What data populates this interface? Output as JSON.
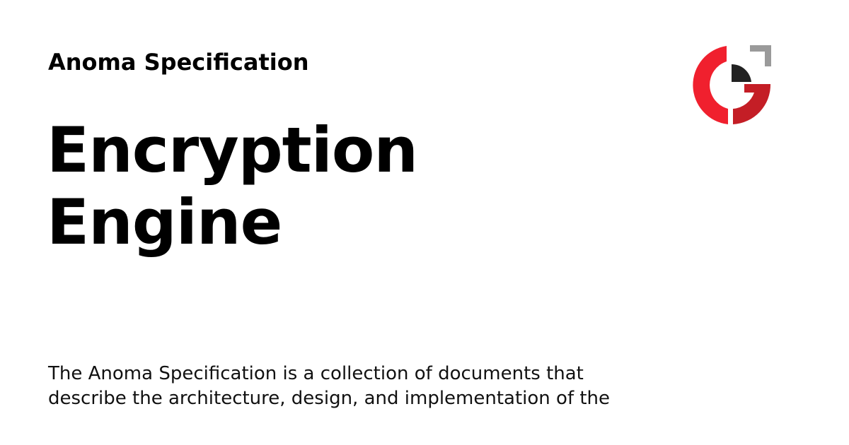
{
  "site": {
    "name": "Anoma Specification"
  },
  "page": {
    "title_lines": [
      "Encryption",
      "Engine"
    ],
    "description_lines": [
      "The Anoma Specification is a collection of documents that",
      "describe the architecture, design, and implementation of the"
    ]
  },
  "logo": {
    "icon": "anoma-logo-icon",
    "colors": {
      "red_light": "#f0202e",
      "red_dark": "#c41e26",
      "dark": "#222222",
      "gray": "#9a9a9a"
    }
  }
}
